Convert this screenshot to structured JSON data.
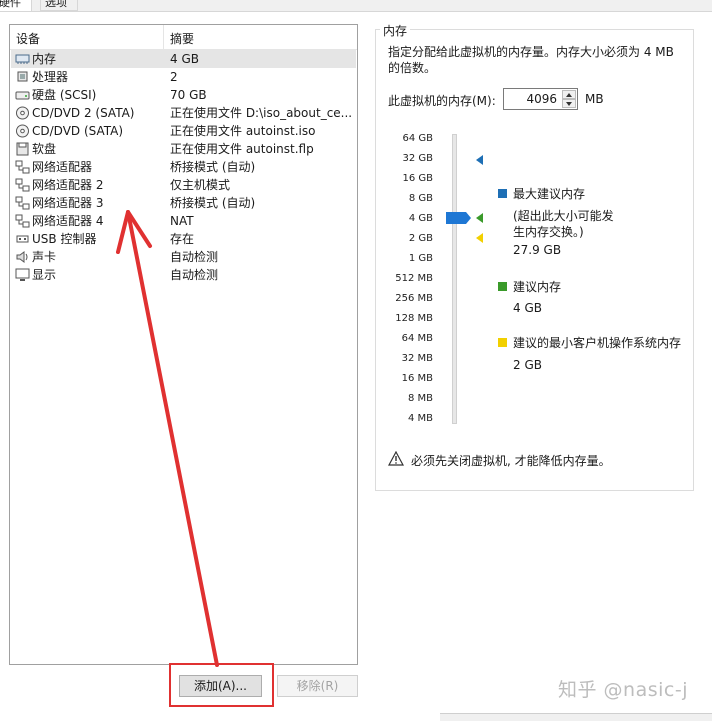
{
  "tabs": [
    "硬件",
    "选项"
  ],
  "device_list": {
    "header": {
      "device": "设备",
      "summary": "摘要"
    },
    "rows": [
      {
        "icon": "memory-icon",
        "name": "内存",
        "summary": "4 GB"
      },
      {
        "icon": "cpu-icon",
        "name": "处理器",
        "summary": "2"
      },
      {
        "icon": "hard-disk-icon",
        "name": "硬盘 (SCSI)",
        "summary": "70 GB"
      },
      {
        "icon": "cd-dvd-icon",
        "name": "CD/DVD 2 (SATA)",
        "summary": "正在使用文件 D:\\iso_about_ce..."
      },
      {
        "icon": "cd-dvd-icon",
        "name": "CD/DVD (SATA)",
        "summary": "正在使用文件 autoinst.iso"
      },
      {
        "icon": "floppy-icon",
        "name": "软盘",
        "summary": "正在使用文件 autoinst.flp"
      },
      {
        "icon": "network-adapter-icon",
        "name": "网络适配器",
        "summary": "桥接模式 (自动)"
      },
      {
        "icon": "network-adapter-icon",
        "name": "网络适配器 2",
        "summary": "仅主机模式"
      },
      {
        "icon": "network-adapter-icon",
        "name": "网络适配器 3",
        "summary": "桥接模式 (自动)"
      },
      {
        "icon": "network-adapter-icon",
        "name": "网络适配器 4",
        "summary": "NAT"
      },
      {
        "icon": "usb-icon",
        "name": "USB 控制器",
        "summary": "存在"
      },
      {
        "icon": "sound-card-icon",
        "name": "声卡",
        "summary": "自动检测"
      },
      {
        "icon": "display-icon",
        "name": "显示",
        "summary": "自动检测"
      }
    ],
    "selected_index": 0
  },
  "buttons": {
    "add": "添加(A)...",
    "remove": "移除(R)"
  },
  "memory": {
    "group_title": "内存",
    "description": "指定分配给此虚拟机的内存量。内存大小必须为 4 MB 的倍数。",
    "label": "此虚拟机的内存(M):",
    "value": "4096",
    "unit": "MB",
    "scale_ticks": [
      "64 GB",
      "32 GB",
      "16 GB",
      "8 GB",
      "4 GB",
      "2 GB",
      "1 GB",
      "512 MB",
      "256 MB",
      "128 MB",
      "64 MB",
      "32 MB",
      "16 MB",
      "8 MB",
      "4 MB"
    ],
    "slider_value": "4 GB",
    "legend": {
      "max": {
        "title": "最大建议内存",
        "note": "(超出此大小可能发生内存交换。)",
        "value": "27.9 GB",
        "color": "#1e6fb5"
      },
      "recommended": {
        "title": "建议内存",
        "value": "4 GB",
        "color": "#3a9a2a"
      },
      "min_guest": {
        "title": "建议的最小客户机操作系统内存",
        "value": "2 GB",
        "color": "#f2d000"
      }
    },
    "warning": "必须先关闭虚拟机, 才能降低内存量。"
  },
  "watermark": "知乎 @nasic-j",
  "colors": {
    "accent": "#1e77d4",
    "annotation": "#e03131"
  }
}
